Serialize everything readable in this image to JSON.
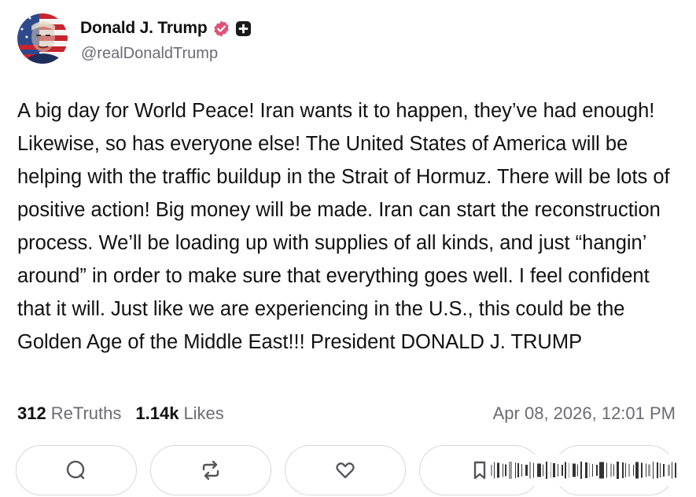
{
  "author": {
    "display_name": "Donald J. Trump",
    "handle": "@realDonaldTrump",
    "avatar_icon": "avatar-flag-portrait",
    "verified_icon": "verified-badge-icon",
    "verified_color": "#e0517a",
    "plus_icon": "plus-badge-icon"
  },
  "post": {
    "text": "A big day for World Peace! Iran wants it to happen, they’ve had enough! Likewise, so has everyone else! The United States of America will be helping with the traffic buildup in the Strait of Hormuz. There will be lots of positive action! Big money will be made. Iran can start the reconstruction process. We’ll be loading up with supplies of all kinds, and just “hangin’ around” in order to make sure that everything goes well. I feel confident that it will. Just like we are experiencing in the U.S., this could be the Golden Age of the Middle East!!! President DONALD J. TRUMP"
  },
  "stats": {
    "retruths_count": "312",
    "retruths_label": "ReTruths",
    "likes_count": "1.14k",
    "likes_label": "Likes",
    "timestamp": "Apr 08, 2026, 12:01 PM"
  },
  "actions": [
    {
      "name": "reply",
      "icon": "comment-icon"
    },
    {
      "name": "retruth",
      "icon": "repost-icon"
    },
    {
      "name": "like",
      "icon": "heart-icon"
    },
    {
      "name": "bookmark",
      "icon": "bookmark-icon"
    },
    {
      "name": "share",
      "icon": "share-icon"
    }
  ],
  "colors": {
    "text": "#111111",
    "muted": "#6b6b70",
    "border": "#d8d8dc",
    "icon": "#55555a"
  }
}
